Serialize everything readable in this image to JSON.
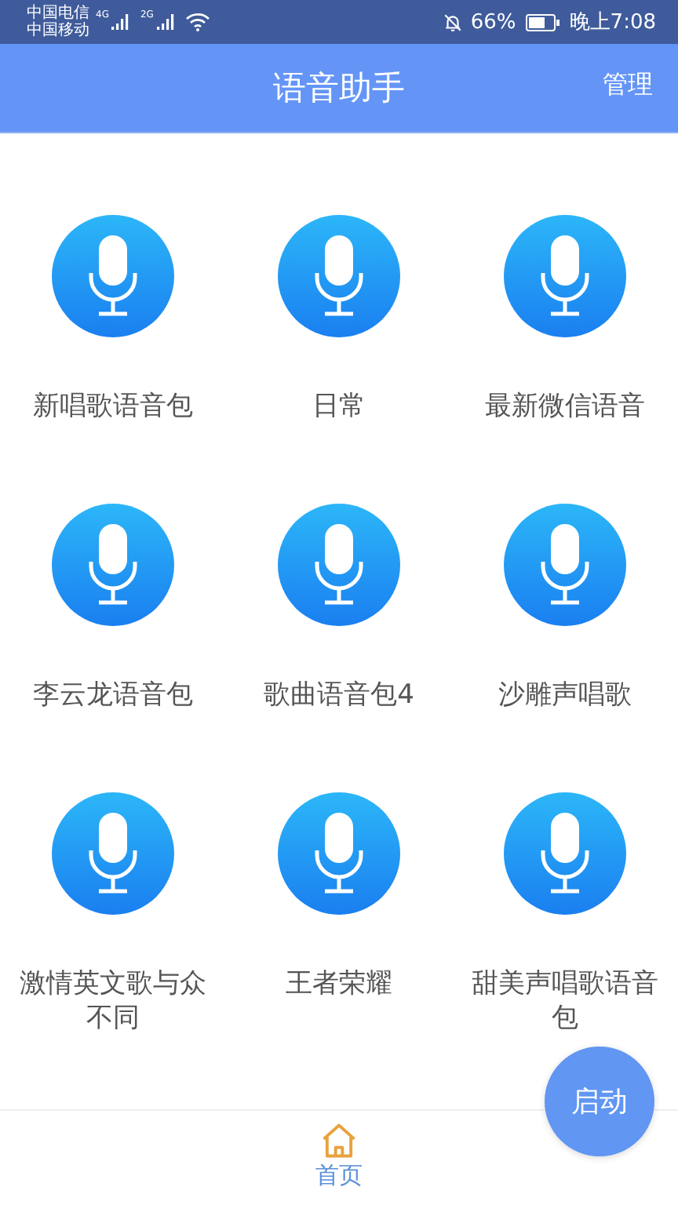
{
  "status_bar": {
    "carriers": [
      "中国电信",
      "中国移动"
    ],
    "network_labels": [
      "4G",
      "2G"
    ],
    "battery": "66%",
    "time": "晚上7:08"
  },
  "header": {
    "title": "语音助手",
    "action": "管理"
  },
  "items": [
    {
      "label": "新唱歌语音包"
    },
    {
      "label": "日常"
    },
    {
      "label": "最新微信语音"
    },
    {
      "label": "李云龙语音包"
    },
    {
      "label": "歌曲语音包4"
    },
    {
      "label": "沙雕声唱歌"
    },
    {
      "label": "激情英文歌与众不同"
    },
    {
      "label": "王者荣耀"
    },
    {
      "label": "甜美声唱歌语音包"
    }
  ],
  "fab": {
    "label": "启动"
  },
  "bottom_nav": [
    {
      "label": "首页",
      "selected": true
    }
  ]
}
